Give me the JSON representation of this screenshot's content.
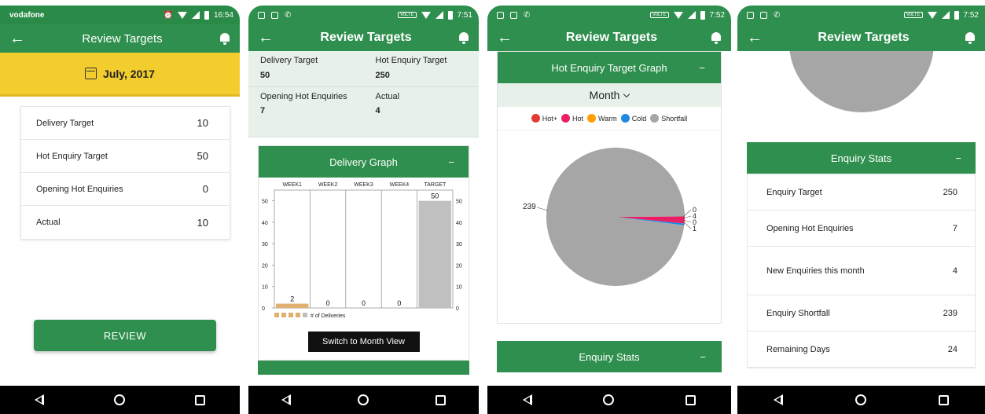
{
  "screens": {
    "s1": {
      "carrier": "vodafone",
      "time": "16:54",
      "title": "Review Targets",
      "month": "July, 2017",
      "rows": [
        {
          "label": "Delivery Target",
          "value": "10"
        },
        {
          "label": "Hot Enquiry Target",
          "value": "50"
        },
        {
          "label": "Opening Hot Enquiries",
          "value": "0"
        },
        {
          "label": "Actual",
          "value": "10"
        }
      ],
      "review_label": "REVIEW"
    },
    "s2": {
      "time": "7:51",
      "title": "Review Targets",
      "cells": [
        {
          "label": "Delivery Target",
          "value": "50"
        },
        {
          "label": "Hot Enquiry Target",
          "value": "250"
        },
        {
          "label": "Opening Hot Enquiries",
          "value": "7"
        },
        {
          "label": "Actual",
          "value": "4"
        }
      ],
      "graph_title": "Delivery Graph",
      "collapse": "−",
      "switch_label": "Switch to Month View"
    },
    "s3": {
      "time": "7:52",
      "title": "Review Targets",
      "graph_title": "Hot Enquiry Target Graph",
      "collapse": "−",
      "period": "Month",
      "stats_title": "Enquiry Stats"
    },
    "s4": {
      "time": "7:52",
      "title": "Review Targets",
      "stats_title": "Enquiry Stats",
      "collapse": "−",
      "rows": [
        {
          "label": "Enquiry Target",
          "value": "250"
        },
        {
          "label": "Opening Hot Enquiries",
          "value": "7"
        },
        {
          "label": "New Enquiries this month",
          "value": "4"
        },
        {
          "label": "Enquiry Shortfall",
          "value": "239"
        },
        {
          "label": "Remaining Days",
          "value": "24"
        }
      ]
    }
  },
  "colors": {
    "primary": "#2f8f4e",
    "month_bar": "#f2cd2d",
    "light_green": "#e7f1ea",
    "delivered_bar": "#e0b070",
    "target_bar": "#c0c0c0",
    "hot_plus": "#e53935",
    "hot": "#e91e63",
    "warm": "#ffa000",
    "cold": "#1e88e5",
    "shortfall": "#a6a6a6"
  },
  "chart_data": [
    {
      "type": "bar",
      "categories": [
        "WEEK1",
        "WEEK2",
        "WEEK3",
        "WEEK4",
        "TARGET"
      ],
      "values": [
        2,
        0,
        0,
        0,
        50
      ],
      "ylim": [
        0,
        55
      ],
      "yticks": [
        0,
        10,
        20,
        30,
        40,
        50
      ],
      "legend": [
        "# of Deliveries"
      ],
      "legend_placement": "bottom-left",
      "grid": true
    },
    {
      "type": "pie",
      "labels": [
        "Hot+",
        "Hot",
        "Warm",
        "Cold",
        "Shortfall"
      ],
      "values": [
        0,
        4,
        0,
        1,
        239
      ],
      "legend_placement": "top"
    }
  ]
}
